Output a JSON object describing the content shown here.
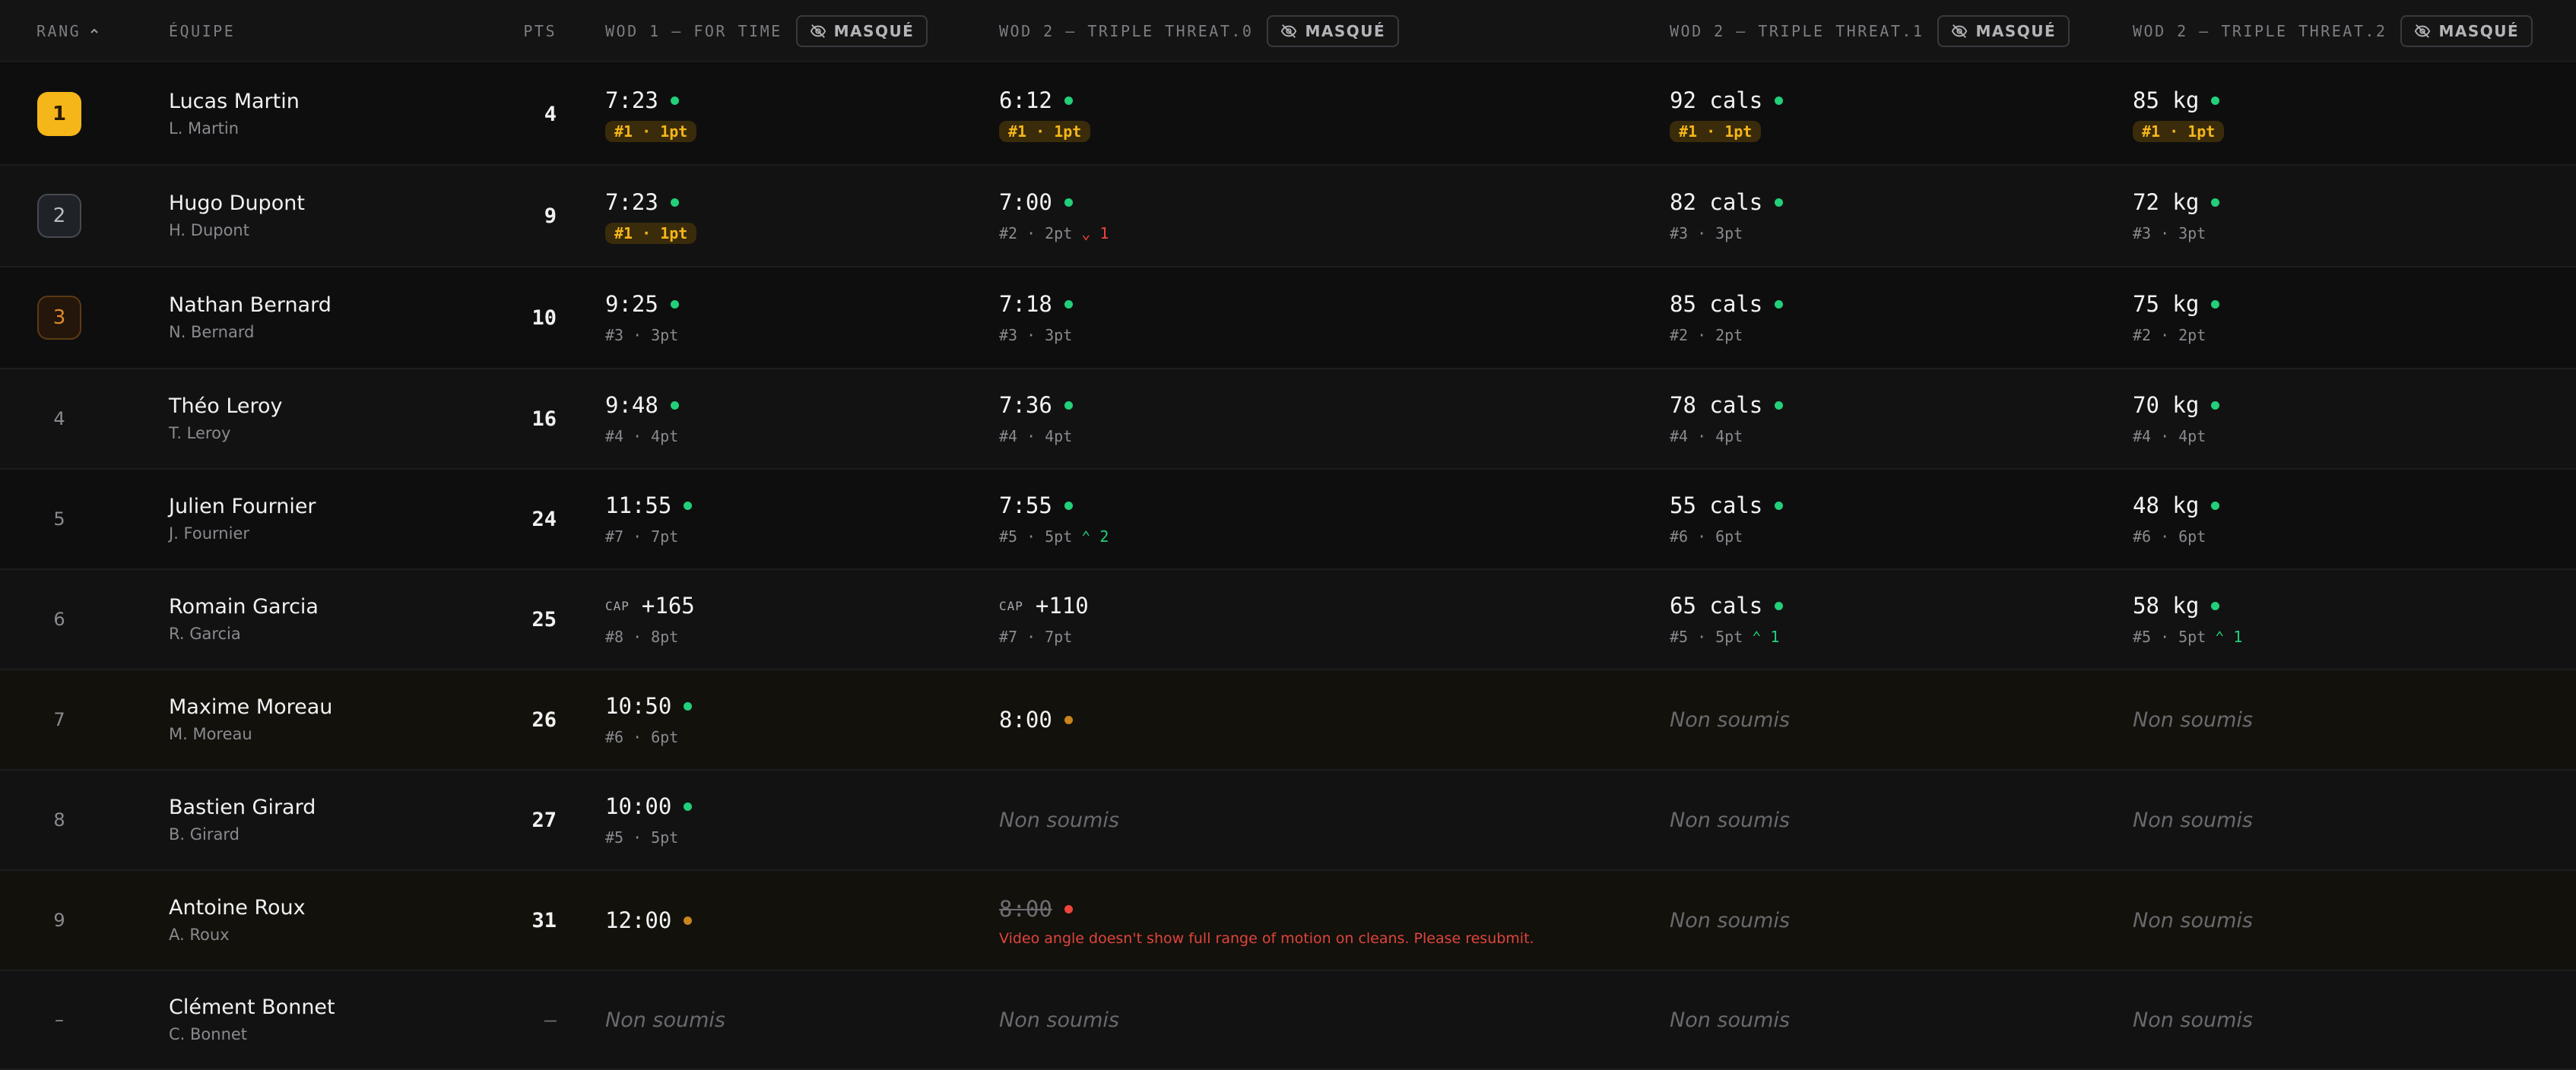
{
  "header": {
    "rank": "RANG",
    "team": "ÉQUIPE",
    "pts": "PTS",
    "hidden_label": "MASQUÉ",
    "wods": [
      "WOD 1 — FOR TIME",
      "WOD 2 — TRIPLE THREAT.0",
      "WOD 2 — TRIPLE THREAT.1",
      "WOD 2 — TRIPLE THREAT.2"
    ]
  },
  "colors": {
    "accent_gold": "#f5b61a",
    "ok_green": "#22d07a",
    "pending_amber": "#c9841d",
    "error_red": "#f0443a"
  },
  "rows": [
    {
      "rank": "1",
      "medal": "gold",
      "name": "Lucas Martin",
      "sub": "L. Martin",
      "pts": "4",
      "scores": [
        {
          "value": "7:23",
          "status": "green",
          "first": "#1 · 1pt"
        },
        {
          "value": "6:12",
          "status": "green",
          "first": "#1 · 1pt"
        },
        {
          "value": "92 cals",
          "status": "green",
          "first": "#1 · 1pt"
        },
        {
          "value": "85 kg",
          "status": "green",
          "first": "#1 · 1pt"
        }
      ]
    },
    {
      "rank": "2",
      "medal": "silver",
      "name": "Hugo Dupont",
      "sub": "H. Dupont",
      "pts": "9",
      "scores": [
        {
          "value": "7:23",
          "status": "green",
          "first": "#1 · 1pt"
        },
        {
          "value": "7:00",
          "status": "green",
          "place": "#2",
          "pts": "2pt",
          "delta": "1",
          "delta_dir": "down"
        },
        {
          "value": "82 cals",
          "status": "green",
          "place": "#3",
          "pts": "3pt"
        },
        {
          "value": "72 kg",
          "status": "green",
          "place": "#3",
          "pts": "3pt"
        }
      ]
    },
    {
      "rank": "3",
      "medal": "bronze",
      "name": "Nathan Bernard",
      "sub": "N. Bernard",
      "pts": "10",
      "scores": [
        {
          "value": "9:25",
          "status": "green",
          "place": "#3",
          "pts": "3pt"
        },
        {
          "value": "7:18",
          "status": "green",
          "place": "#3",
          "pts": "3pt"
        },
        {
          "value": "85 cals",
          "status": "green",
          "place": "#2",
          "pts": "2pt"
        },
        {
          "value": "75 kg",
          "status": "green",
          "place": "#2",
          "pts": "2pt"
        }
      ]
    },
    {
      "rank": "4",
      "name": "Théo Leroy",
      "sub": "T. Leroy",
      "pts": "16",
      "scores": [
        {
          "value": "9:48",
          "status": "green",
          "place": "#4",
          "pts": "4pt"
        },
        {
          "value": "7:36",
          "status": "green",
          "place": "#4",
          "pts": "4pt"
        },
        {
          "value": "78 cals",
          "status": "green",
          "place": "#4",
          "pts": "4pt"
        },
        {
          "value": "70 kg",
          "status": "green",
          "place": "#4",
          "pts": "4pt"
        }
      ]
    },
    {
      "rank": "5",
      "name": "Julien Fournier",
      "sub": "J. Fournier",
      "pts": "24",
      "scores": [
        {
          "value": "11:55",
          "status": "green",
          "place": "#7",
          "pts": "7pt"
        },
        {
          "value": "7:55",
          "status": "green",
          "place": "#5",
          "pts": "5pt",
          "delta": "2",
          "delta_dir": "up"
        },
        {
          "value": "55 cals",
          "status": "green",
          "place": "#6",
          "pts": "6pt"
        },
        {
          "value": "48 kg",
          "status": "green",
          "place": "#6",
          "pts": "6pt"
        }
      ]
    },
    {
      "rank": "6",
      "name": "Romain Garcia",
      "sub": "R. Garcia",
      "pts": "25",
      "scores": [
        {
          "cap": "CAP",
          "value": "+165",
          "place": "#8",
          "pts": "8pt"
        },
        {
          "cap": "CAP",
          "value": "+110",
          "place": "#7",
          "pts": "7pt"
        },
        {
          "value": "65 cals",
          "status": "green",
          "place": "#5",
          "pts": "5pt",
          "delta": "1",
          "delta_dir": "up"
        },
        {
          "value": "58 kg",
          "status": "green",
          "place": "#5",
          "pts": "5pt",
          "delta": "1",
          "delta_dir": "up"
        }
      ]
    },
    {
      "rank": "7",
      "pending": true,
      "name": "Maxime Moreau",
      "sub": "M. Moreau",
      "pts": "26",
      "scores": [
        {
          "value": "10:50",
          "status": "green",
          "place": "#6",
          "pts": "6pt"
        },
        {
          "value": "8:00",
          "status": "amber"
        },
        {
          "empty": "Non soumis"
        },
        {
          "empty": "Non soumis"
        }
      ]
    },
    {
      "rank": "8",
      "name": "Bastien Girard",
      "sub": "B. Girard",
      "pts": "27",
      "scores": [
        {
          "value": "10:00",
          "status": "green",
          "place": "#5",
          "pts": "5pt"
        },
        {
          "empty": "Non soumis"
        },
        {
          "empty": "Non soumis"
        },
        {
          "empty": "Non soumis"
        }
      ]
    },
    {
      "rank": "9",
      "pending": true,
      "name": "Antoine Roux",
      "sub": "A. Roux",
      "pts": "31",
      "scores": [
        {
          "value": "12:00",
          "status": "amber"
        },
        {
          "value": "8:00",
          "status": "red",
          "struck": true,
          "message": "Video angle doesn't show full range of motion on cleans. Please resubmit."
        },
        {
          "empty": "Non soumis"
        },
        {
          "empty": "Non soumis"
        }
      ]
    },
    {
      "rank": "–",
      "name": "Clément Bonnet",
      "sub": "C. Bonnet",
      "pts": "–",
      "scores": [
        {
          "empty": "Non soumis"
        },
        {
          "empty": "Non soumis"
        },
        {
          "empty": "Non soumis"
        },
        {
          "empty": "Non soumis"
        }
      ]
    }
  ]
}
